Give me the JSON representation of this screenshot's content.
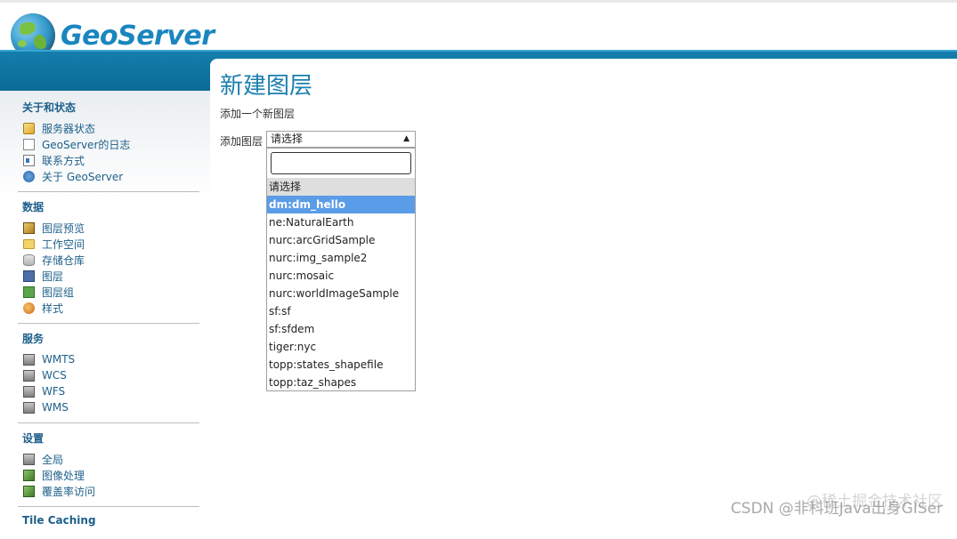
{
  "app": {
    "logo_text": "GeoServer"
  },
  "sidebar": {
    "sections": [
      {
        "title": "关于和状态",
        "items": [
          {
            "label": "服务器状态",
            "icon": "server-status-icon"
          },
          {
            "label": "GeoServer的日志",
            "icon": "log-document-icon"
          },
          {
            "label": "联系方式",
            "icon": "contact-card-icon"
          },
          {
            "label": "关于 GeoServer",
            "icon": "info-icon"
          }
        ]
      },
      {
        "title": "数据",
        "items": [
          {
            "label": "图层预览",
            "icon": "layer-preview-icon"
          },
          {
            "label": "工作空间",
            "icon": "folder-icon"
          },
          {
            "label": "存储仓库",
            "icon": "database-icon"
          },
          {
            "label": "图层",
            "icon": "layer-icon"
          },
          {
            "label": "图层组",
            "icon": "layer-group-icon"
          },
          {
            "label": "样式",
            "icon": "style-palette-icon"
          }
        ]
      },
      {
        "title": "服务",
        "items": [
          {
            "label": "WMTS",
            "icon": "service-icon"
          },
          {
            "label": "WCS",
            "icon": "service-icon"
          },
          {
            "label": "WFS",
            "icon": "service-icon"
          },
          {
            "label": "WMS",
            "icon": "service-icon"
          }
        ]
      },
      {
        "title": "设置",
        "items": [
          {
            "label": "全局",
            "icon": "server-icon"
          },
          {
            "label": "图像处理",
            "icon": "image-icon"
          },
          {
            "label": "覆盖率访问",
            "icon": "image-icon"
          }
        ]
      },
      {
        "title": "Tile Caching",
        "items": []
      }
    ]
  },
  "main": {
    "title": "新建图层",
    "description": "添加一个新图层",
    "add_layer_label": "添加图层",
    "select": {
      "selected": "请选择",
      "options": [
        "请选择",
        "dm:dm_hello",
        "ne:NaturalEarth",
        "nurc:arcGridSample",
        "nurc:img_sample2",
        "nurc:mosaic",
        "nurc:worldImageSample",
        "sf:sf",
        "sf:sfdem",
        "tiger:nyc",
        "topp:states_shapefile",
        "topp:taz_shapes"
      ],
      "highlighted": "dm:dm_hello"
    }
  },
  "watermark": "CSDN @非科班Java出身GISer",
  "watermark_overlay": "@稀土掘金技术社区"
}
